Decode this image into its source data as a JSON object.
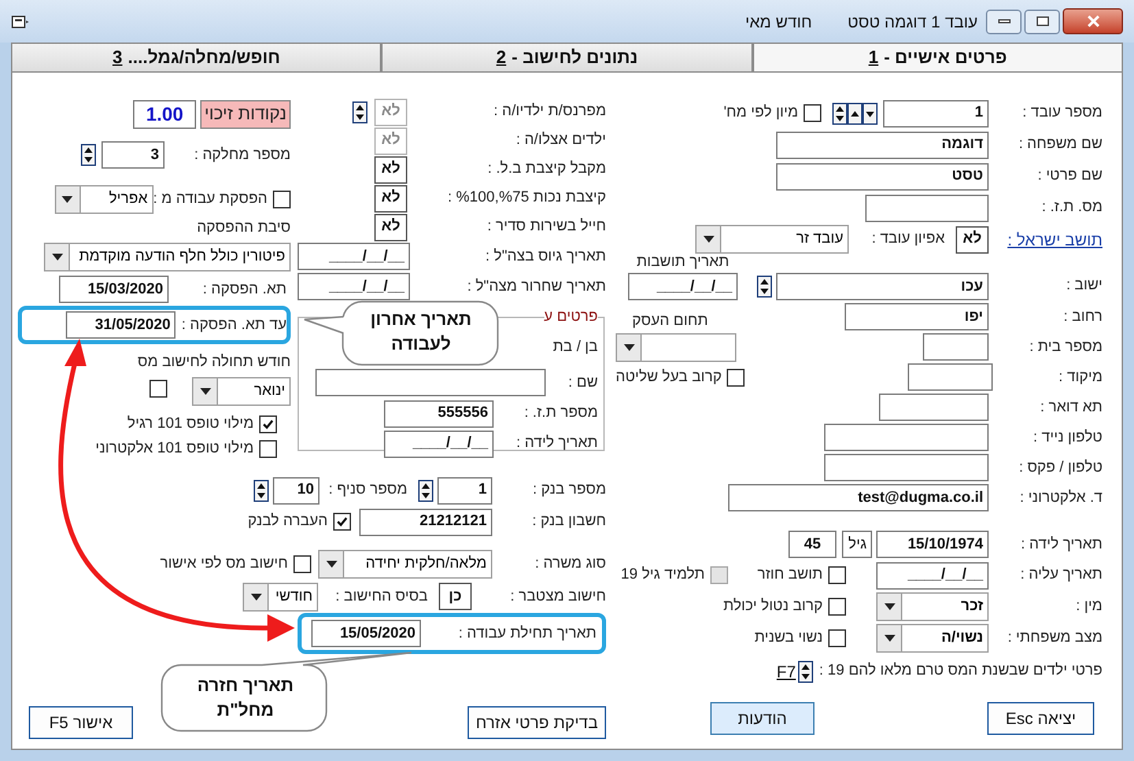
{
  "window": {
    "title": "עובד 1 דוגמה טסט",
    "month": "חודש מאי"
  },
  "tabs": [
    {
      "label": "פרטים אישיים -",
      "hotkey": "1",
      "selected": true
    },
    {
      "label": "נתונים לחישוב -",
      "hotkey": "2",
      "selected": false
    },
    {
      "label": "חופש/מחלה/גמל....",
      "hotkey": "3",
      "selected": false
    }
  ],
  "personal": {
    "employee_number": {
      "label": "מספר עובד :",
      "value": "1"
    },
    "sort_by_department": {
      "label": "מיון לפי מח'",
      "checked": false
    },
    "last_name": {
      "label": "שם משפחה :",
      "value": "דוגמה"
    },
    "first_name": {
      "label": "שם פרטי :",
      "value": "טסט"
    },
    "id_number": {
      "label": "מס. ת.ז. :"
    },
    "israeli_resident": {
      "label": "תושב ישראל :",
      "value": "לא"
    },
    "employee_type": {
      "label": "אפיון עובד :",
      "value": "עובד זר"
    },
    "settlement": {
      "label": "ישוב :",
      "value": "עכו"
    },
    "residence_date": {
      "label": "תאריך תושבות",
      "value": "__/__/____"
    },
    "street": {
      "label": "רחוב :",
      "value": "יפו"
    },
    "business_field": {
      "label": "תחום העסק"
    },
    "house_number": {
      "label": "מספר בית :"
    },
    "zip": {
      "label": "מיקוד :"
    },
    "related_controlling": {
      "label": "קרוב בעל שליטה",
      "checked": false
    },
    "po_box": {
      "label": "תא דואר :"
    },
    "mobile": {
      "label": "טלפון נייד :"
    },
    "phone_fax": {
      "label": "טלפון / פקס :"
    },
    "email": {
      "label": "ד. אלקטרוני :",
      "value": "test@dugma.co.il"
    },
    "birth_date": {
      "label": "תאריך לידה :",
      "value": "15/10/1974"
    },
    "age": {
      "label": "גיל",
      "value": "45"
    },
    "immigration_date": {
      "label": "תאריך עליה :",
      "value": "__/__/____"
    },
    "returning_resident": {
      "label": "תושב חוזר",
      "checked": false
    },
    "student_19": {
      "label": "תלמיד גיל 19",
      "checked": false,
      "disabled": true
    },
    "gender": {
      "label": "מין :",
      "value": "זכר"
    },
    "disabled_relative": {
      "label": "קרוב נטול יכולת",
      "checked": false
    },
    "marital_status": {
      "label": "מצב משפחתי :",
      "value": "נשוי/ה"
    },
    "remarried": {
      "label": "נשוי בשנית",
      "checked": false
    },
    "children_under_19": {
      "label": "פרטי ילדים שבשנת המס טרם מלאו להם 19 :",
      "link": "F7"
    }
  },
  "status": {
    "supports_children": {
      "label": "מפרנס/ת ילדיו/ה :",
      "value": "לא",
      "disabled": true
    },
    "children_with": {
      "label": "ילדים אצלו/ה :",
      "value": "לא",
      "disabled": true
    },
    "nii_allowance": {
      "label": "מקבל קיצבת  ב.ל. :",
      "value": "לא",
      "disabled": false
    },
    "disability_allowance": {
      "label": "קיצבת נכות %75,%100 :",
      "value": "לא",
      "disabled": false
    },
    "soldier": {
      "label": "חייל בשירות סדיר :",
      "value": "לא",
      "disabled": false
    },
    "enlist_date": {
      "label": "תאריך גיוס בצה\"ל :",
      "value": "__/__/____"
    },
    "discharge_date": {
      "label": "תאריך שחרור מצה\"ל :",
      "value": "__/__/____"
    }
  },
  "spouse": {
    "title": "פרטים ע",
    "child_label": "בן / בת",
    "name_label": "שם :",
    "id_label": "מספר ת.ז. :",
    "id_value": "555556",
    "birth_label": "תאריך לידה :",
    "birth_value": "__/__/____"
  },
  "bank": {
    "bank_number": {
      "label": "מספר בנק :",
      "value": "1"
    },
    "branch": {
      "label": "מספר סניף :",
      "value": "10"
    },
    "account": {
      "label": "חשבון בנק :",
      "value": "21212121"
    },
    "transfer": {
      "label": "העברה לבנק",
      "checked": true
    }
  },
  "job": {
    "job_type": {
      "label": "סוג משרה :",
      "value": "מלאה/חלקית יחידה"
    },
    "tax_by_approval": {
      "label": "חישוב מס לפי אישור",
      "checked": false
    },
    "cumulative": {
      "label": "חישוב מצטבר :",
      "value": "כן"
    },
    "calc_basis": {
      "label": "בסיס החישוב :",
      "value": "חודשי"
    },
    "start_date": {
      "label": "תאריך תחילת עבודה :",
      "value": "15/05/2020",
      "highlighted": true
    }
  },
  "termination": {
    "credit_points": {
      "label": "נקודות זיכוי",
      "value": "1.00"
    },
    "department": {
      "label": "מספר מחלקה :",
      "value": "3"
    },
    "stop_work": {
      "label": "הפסקת עבודה מ :",
      "checked": false,
      "value": "אפריל"
    },
    "stop_reason": {
      "label": "סיבת ההפסקה",
      "value": "פיטורין כולל חלף הודעה מוקדמת"
    },
    "stop_date": {
      "label": "תא. הפסקה :",
      "value": "15/03/2020"
    },
    "until_stop_date": {
      "label": "עד תא. הפסקה :",
      "value": "31/05/2020",
      "highlighted": true
    },
    "tax_month": {
      "label": "חודש תחולה לחישוב מס",
      "value": "ינואר",
      "checked": false
    },
    "form101_regular": {
      "label": "מילוי טופס 101 רגיל",
      "checked": true
    },
    "form101_electronic": {
      "label": "מילוי טופס 101 אלקטרוני",
      "checked": false
    }
  },
  "buttons": [
    {
      "label": "יציאה Esc",
      "focused": false
    },
    {
      "label": "הודעות",
      "focused": true
    },
    {
      "label": "בדיקת פרטי אזרח",
      "focused": false
    },
    {
      "label": "אישור F5",
      "focused": false
    }
  ],
  "callouts": [
    {
      "text": "תאריך אחרון לעבודה"
    },
    {
      "text": "תאריך חזרה מחל\"ת"
    }
  ]
}
